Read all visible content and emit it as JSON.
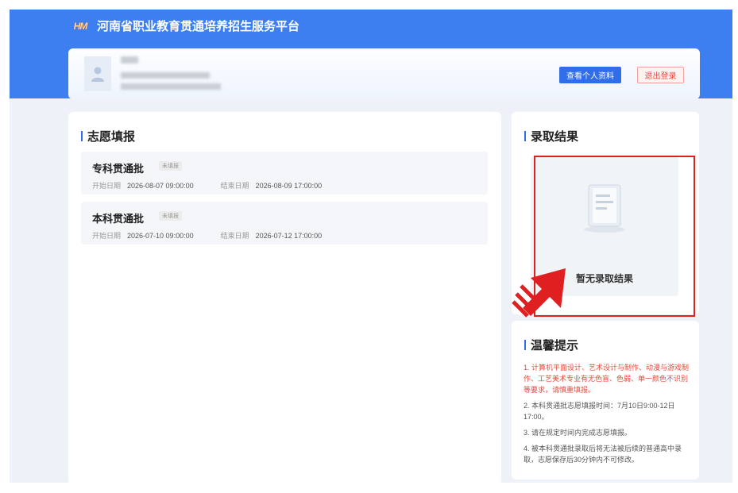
{
  "header": {
    "logo_text": "HM",
    "title": "河南省职业教育贯通培养招生服务平台"
  },
  "profile": {
    "view_profile_label": "查看个人资料",
    "logout_label": "退出登录"
  },
  "volunteer": {
    "title": "志愿填报",
    "items": [
      {
        "name": "专科贯通批",
        "status": "未填报",
        "start_label": "开始日期",
        "start": "2026-08-07 09:00:00",
        "end_label": "结束日期",
        "end": "2026-08-09 17:00:00"
      },
      {
        "name": "本科贯通批",
        "status": "未填报",
        "start_label": "开始日期",
        "start": "2026-07-10 09:00:00",
        "end_label": "结束日期",
        "end": "2026-07-12 17:00:00"
      }
    ]
  },
  "admission": {
    "title": "录取结果",
    "empty_text": "暂无录取结果"
  },
  "tips": {
    "title": "温馨提示",
    "items": [
      "1. 计算机平面设计、艺术设计与制作、动漫与游戏制作、工艺美术专业有无色盲、色弱、单一颜色不识别等要求，请慎重填报。",
      "2. 本科贯通批志愿填报时间：7月10日9:00-12日17:00。",
      "3. 请在规定时间内完成志愿填报。",
      "4. 被本科贯通批录取后将无法被后续的普通高中录取，志愿保存后30分钟内不可修改。"
    ]
  },
  "colors": {
    "primary": "#3d7ef0",
    "accent_red": "#e02020",
    "tip_red": "#e84a3d"
  }
}
